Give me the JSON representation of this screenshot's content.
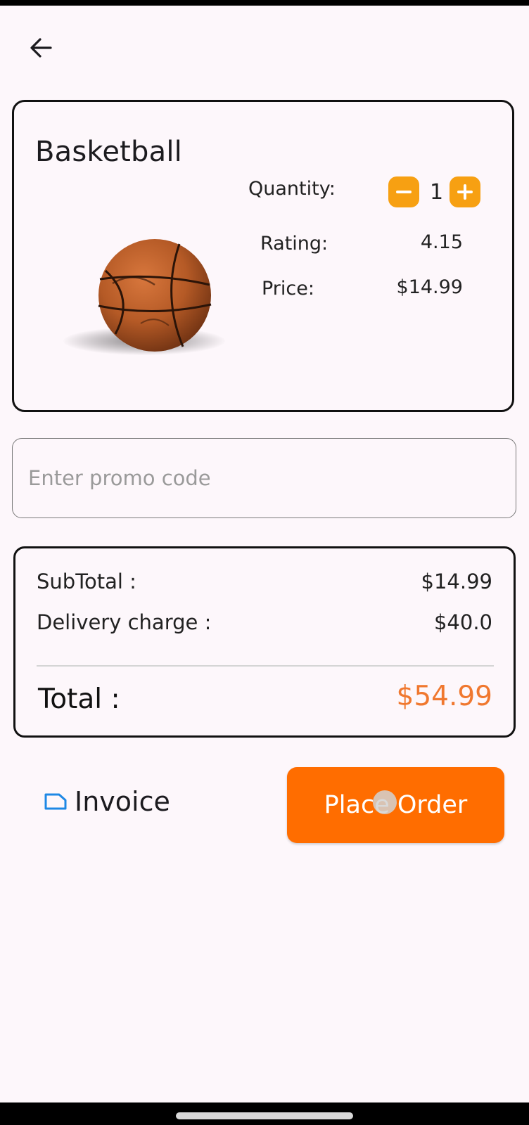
{
  "header": {
    "back_icon": "arrow-left-icon"
  },
  "product": {
    "title": "Basketball",
    "image_icon": "basketball-image",
    "quantity_label": "Quantity:",
    "quantity_value": "1",
    "rating_label": "Rating:",
    "rating_value": "4.15",
    "price_label": "Price:",
    "price_value": "$14.99"
  },
  "promo": {
    "placeholder": "Enter promo code",
    "value": ""
  },
  "summary": {
    "subtotal_label": "SubTotal :",
    "subtotal_value": "$14.99",
    "delivery_label": "Delivery charge :",
    "delivery_value": "$40.0",
    "total_label": "Total :",
    "total_value": "$54.99"
  },
  "actions": {
    "invoice_label": "Invoice",
    "invoice_icon": "document-icon",
    "place_order_label": "Place Order"
  },
  "colors": {
    "accent": "#ff6d00",
    "qty_button": "#f7a012",
    "total": "#f0782f",
    "invoice_icon": "#1e88e5"
  }
}
